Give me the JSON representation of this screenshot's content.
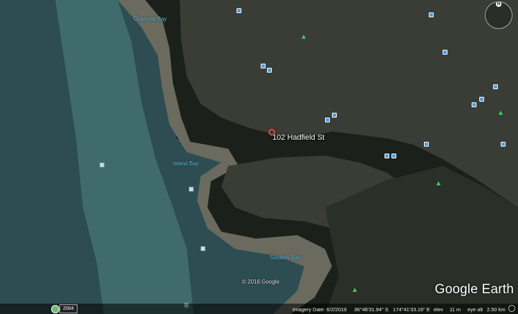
{
  "map": {
    "colors": {
      "water_deep": "#2e4d52",
      "water_channel": "#3f6b6c",
      "mudflat": "#6b6a5e",
      "land_dark": "#1b201b",
      "land_mid": "#2a3028",
      "urban": "#3a3c36"
    },
    "place_label": "102 Hadfield St",
    "bays": [
      {
        "id": "charcoal",
        "name": "Charcoal Bay"
      },
      {
        "id": "island",
        "name": "Island Bay"
      },
      {
        "id": "soldiers",
        "name": "Soldiers Bay"
      }
    ],
    "copyright": "© 2016 Google",
    "logo": "Google Earth",
    "historical_year": "2004",
    "compass_north": "N"
  },
  "status": {
    "imagery_date": "Imagery Date: 6/2/2016",
    "latitude": "36°48'31.94\" S",
    "longitude": "174°41'33.16\" E",
    "elev_label": "elev",
    "elevation": "11 m",
    "eye_alt_label": "eye alt",
    "eye_alt": "2.50 km"
  }
}
